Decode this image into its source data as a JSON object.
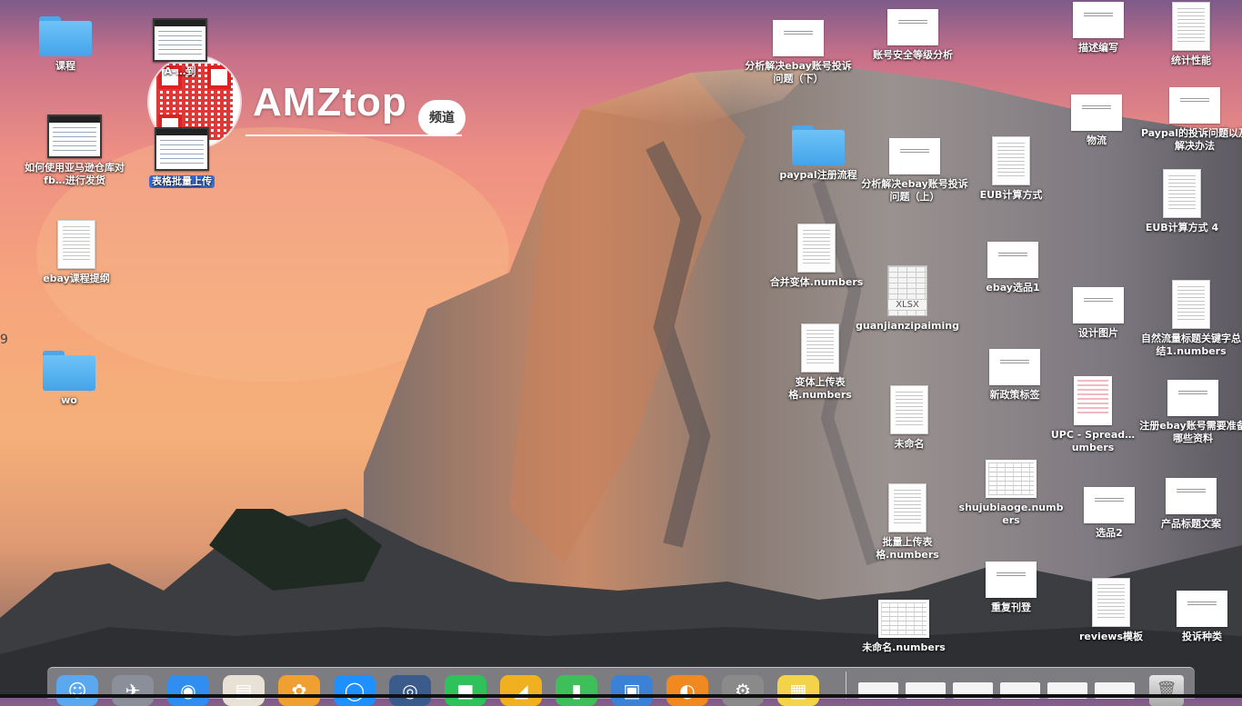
{
  "watermark": {
    "brand": "AMZtop",
    "badge": "频道",
    "edge_digit": "9"
  },
  "desktop": {
    "left_icons": [
      {
        "label": "课程",
        "kind": "folder"
      },
      {
        "label": "A-…到",
        "kind": "screenshot"
      },
      {
        "label": "如何使用亚马逊仓库对fb…进行发货",
        "kind": "screenshot"
      },
      {
        "label": "表格批量上传",
        "kind": "screenshot",
        "selected": true
      },
      {
        "label": "ebay课程提纲",
        "kind": "document"
      },
      {
        "label": "wo",
        "kind": "folder"
      }
    ],
    "right_icons": [
      {
        "label": "分析解决ebay账号投诉问题（下）",
        "kind": "slide"
      },
      {
        "label": "账号安全等级分析",
        "kind": "slide"
      },
      {
        "label": "描述编写",
        "kind": "slide"
      },
      {
        "label": "统计性能",
        "kind": "document"
      },
      {
        "label": "paypal注册流程",
        "kind": "folder"
      },
      {
        "label": "分析解决ebay账号投诉问题（上）",
        "kind": "slide"
      },
      {
        "label": "EUB计算方式",
        "kind": "document"
      },
      {
        "label": "物流",
        "kind": "slide"
      },
      {
        "label": "Paypal的投诉问题以及解决办法",
        "kind": "slide"
      },
      {
        "label": "EUB计算方式 4",
        "kind": "document"
      },
      {
        "label": "合并变体.numbers",
        "kind": "document"
      },
      {
        "label": "guanjianzipaiming",
        "kind": "xlsx",
        "badge": "XLSX"
      },
      {
        "label": "ebay选品1",
        "kind": "slide"
      },
      {
        "label": "设计图片",
        "kind": "slide"
      },
      {
        "label": "自然流量标题关键字总结1.numbers",
        "kind": "document"
      },
      {
        "label": "变体上传表格.numbers",
        "kind": "document"
      },
      {
        "label": "新政策标签",
        "kind": "slide"
      },
      {
        "label": "未命名",
        "kind": "document"
      },
      {
        "label": "UPC - Spread…umbers",
        "kind": "pink"
      },
      {
        "label": "注册ebay账号需要准备哪些资料",
        "kind": "slide"
      },
      {
        "label": "shujubiaoge.numbers",
        "kind": "sheet"
      },
      {
        "label": "选品2",
        "kind": "slide"
      },
      {
        "label": "产品标题文案",
        "kind": "slide"
      },
      {
        "label": "批量上传表格.numbers",
        "kind": "document"
      },
      {
        "label": "重复刊登",
        "kind": "slide"
      },
      {
        "label": "reviews模板",
        "kind": "document"
      },
      {
        "label": "投诉种类",
        "kind": "slide"
      },
      {
        "label": "未命名.numbers",
        "kind": "sheet"
      }
    ]
  },
  "dock": {
    "apps": [
      {
        "name": "finder",
        "glyph": "☺",
        "color": "#5aa8f0"
      },
      {
        "name": "launchpad",
        "glyph": "✈",
        "color": "#8a8f99"
      },
      {
        "name": "safari",
        "glyph": "◉",
        "color": "#2f8ef0"
      },
      {
        "name": "contacts",
        "glyph": "▤",
        "color": "#e8e2d6"
      },
      {
        "name": "photos",
        "glyph": "✿",
        "color": "#f0a030"
      },
      {
        "name": "app-store",
        "glyph": "◯",
        "color": "#1e90ff"
      },
      {
        "name": "quicktime",
        "glyph": "◎",
        "color": "#3a5b8c"
      },
      {
        "name": "facetime",
        "glyph": "■",
        "color": "#2ec25a"
      },
      {
        "name": "keynote",
        "glyph": "◢",
        "color": "#f0b020"
      },
      {
        "name": "numbers",
        "glyph": "▮",
        "color": "#3fbf5a"
      },
      {
        "name": "preview",
        "glyph": "▣",
        "color": "#3b82d6"
      },
      {
        "name": "ibooks",
        "glyph": "◐",
        "color": "#f08a20"
      },
      {
        "name": "system-preferences",
        "glyph": "⚙",
        "color": "#8a8a8a"
      },
      {
        "name": "stickies",
        "glyph": "▦",
        "color": "#f2d34a"
      }
    ],
    "stack_items": 6
  }
}
